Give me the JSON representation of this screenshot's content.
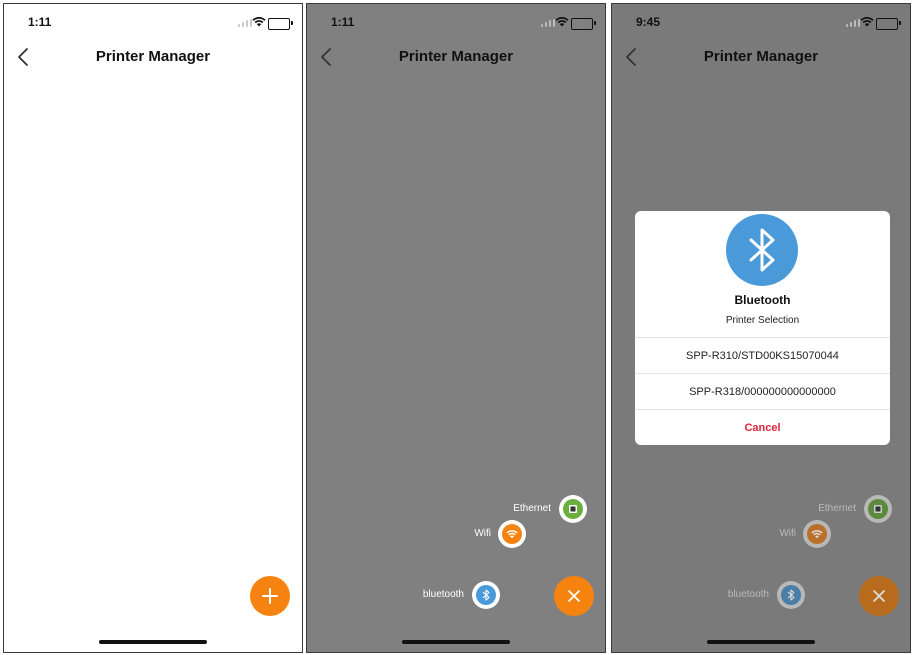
{
  "screens": [
    {
      "status": {
        "time": "1:11"
      },
      "nav": {
        "title": "Printer Manager"
      },
      "fab": {
        "icon": "plus-icon"
      }
    },
    {
      "status": {
        "time": "1:11"
      },
      "nav": {
        "title": "Printer Manager"
      },
      "menu": {
        "ethernet": "Ethernet",
        "wifi": "Wifi",
        "bluetooth": "bluetooth"
      },
      "fab": {
        "icon": "close-icon"
      }
    },
    {
      "status": {
        "time": "9:45"
      },
      "nav": {
        "title": "Printer Manager"
      },
      "menu": {
        "ethernet": "Ethernet",
        "wifi": "Wifi",
        "bluetooth": "bluetooth"
      },
      "dialog": {
        "title": "Bluetooth",
        "subtitle": "Printer Selection",
        "devices": [
          "SPP-R310/STD00KS15070044",
          "SPP-R318/000000000000000"
        ],
        "cancel": "Cancel"
      },
      "fab": {
        "icon": "close-icon"
      }
    }
  ],
  "colors": {
    "accent": "#f6830f",
    "bluetooth": "#4a9ad9",
    "wifi": "#f6830f",
    "ethernet": "#6aaf3d",
    "cancel": "#e0263d"
  }
}
